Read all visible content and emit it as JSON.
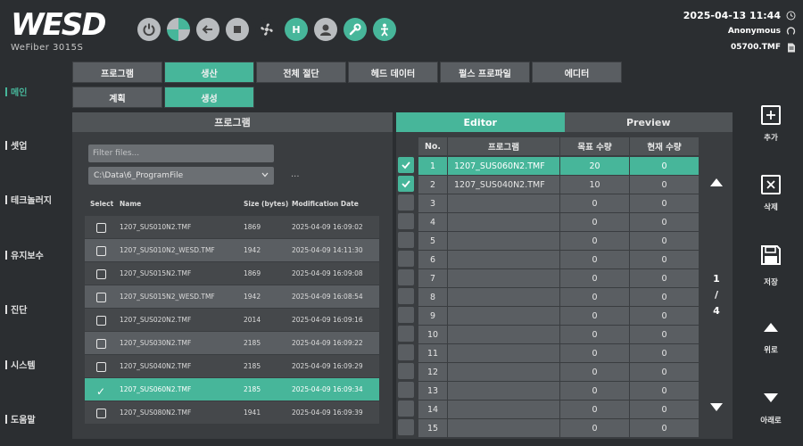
{
  "brand": {
    "logo": "WESD",
    "model": "WeFiber 3015S"
  },
  "status": {
    "datetime": "2025-04-13 11:44",
    "user": "Anonymous",
    "file": "05700.TMF"
  },
  "top_icons": [
    "power-icon",
    "gauge-icon",
    "login-icon",
    "stop-icon",
    "fan-icon",
    "home-icon",
    "user-icon",
    "wrench-icon",
    "operator-icon"
  ],
  "nav": [
    "메인",
    "셋업",
    "테크놀러지",
    "유지보수",
    "진단",
    "시스템",
    "도움말"
  ],
  "tabs": [
    "프로그램",
    "생산",
    "전체 절단",
    "헤드 데이터",
    "펄스 프로파일",
    "에디터"
  ],
  "subtabs": [
    "계획",
    "생성"
  ],
  "program_panel": {
    "title": "프로그램",
    "filter_placeholder": "Filter files...",
    "path": "C:\\Data\\6_ProgramFile",
    "dots": "...",
    "columns": {
      "select": "Select",
      "name": "Name",
      "size": "Size (bytes)",
      "date": "Modification Date"
    },
    "files": [
      {
        "name": "1207_SUS010N2.TMF",
        "size": "1869",
        "date": "2025-04-09 16:09:02"
      },
      {
        "name": "1207_SUS010N2_WESD.TMF",
        "size": "1942",
        "date": "2025-04-09 14:11:30"
      },
      {
        "name": "1207_SUS015N2.TMF",
        "size": "1869",
        "date": "2025-04-09 16:09:08"
      },
      {
        "name": "1207_SUS015N2_WESD.TMF",
        "size": "1942",
        "date": "2025-04-09 16:08:54"
      },
      {
        "name": "1207_SUS020N2.TMF",
        "size": "2014",
        "date": "2025-04-09 16:09:16"
      },
      {
        "name": "1207_SUS030N2.TMF",
        "size": "2185",
        "date": "2025-04-09 16:09:22"
      },
      {
        "name": "1207_SUS040N2.TMF",
        "size": "2185",
        "date": "2025-04-09 16:09:29"
      },
      {
        "name": "1207_SUS060N2.TMF",
        "size": "2185",
        "date": "2025-04-09 16:09:34",
        "checked": true
      },
      {
        "name": "1207_SUS080N2.TMF",
        "size": "1941",
        "date": "2025-04-09 16:09:39"
      }
    ]
  },
  "editor": {
    "tabs": [
      "Editor",
      "Preview"
    ],
    "columns": {
      "no": "No.",
      "program": "프로그램",
      "target": "목표 수량",
      "current": "현재 수량"
    },
    "rows": [
      {
        "no": "1",
        "program": "1207_SUS060N2.TMF",
        "target": "20",
        "current": "0",
        "checked": true,
        "selected": true
      },
      {
        "no": "2",
        "program": "1207_SUS040N2.TMF",
        "target": "10",
        "current": "0",
        "checked": true
      },
      {
        "no": "3",
        "program": "",
        "target": "0",
        "current": "0"
      },
      {
        "no": "4",
        "program": "",
        "target": "0",
        "current": "0"
      },
      {
        "no": "5",
        "program": "",
        "target": "0",
        "current": "0"
      },
      {
        "no": "6",
        "program": "",
        "target": "0",
        "current": "0"
      },
      {
        "no": "7",
        "program": "",
        "target": "0",
        "current": "0"
      },
      {
        "no": "8",
        "program": "",
        "target": "0",
        "current": "0"
      },
      {
        "no": "9",
        "program": "",
        "target": "0",
        "current": "0"
      },
      {
        "no": "10",
        "program": "",
        "target": "0",
        "current": "0"
      },
      {
        "no": "11",
        "program": "",
        "target": "0",
        "current": "0"
      },
      {
        "no": "12",
        "program": "",
        "target": "0",
        "current": "0"
      },
      {
        "no": "13",
        "program": "",
        "target": "0",
        "current": "0"
      },
      {
        "no": "14",
        "program": "",
        "target": "0",
        "current": "0"
      },
      {
        "no": "15",
        "program": "",
        "target": "0",
        "current": "0"
      }
    ],
    "page": {
      "current": "1",
      "sep": "/",
      "total": "4"
    }
  },
  "actions": {
    "add": "추가",
    "delete": "삭제",
    "save": "저장",
    "up": "위로",
    "down": "아래로"
  },
  "colors": {
    "accent": "#47b69a",
    "bg": "#2b2e31"
  }
}
